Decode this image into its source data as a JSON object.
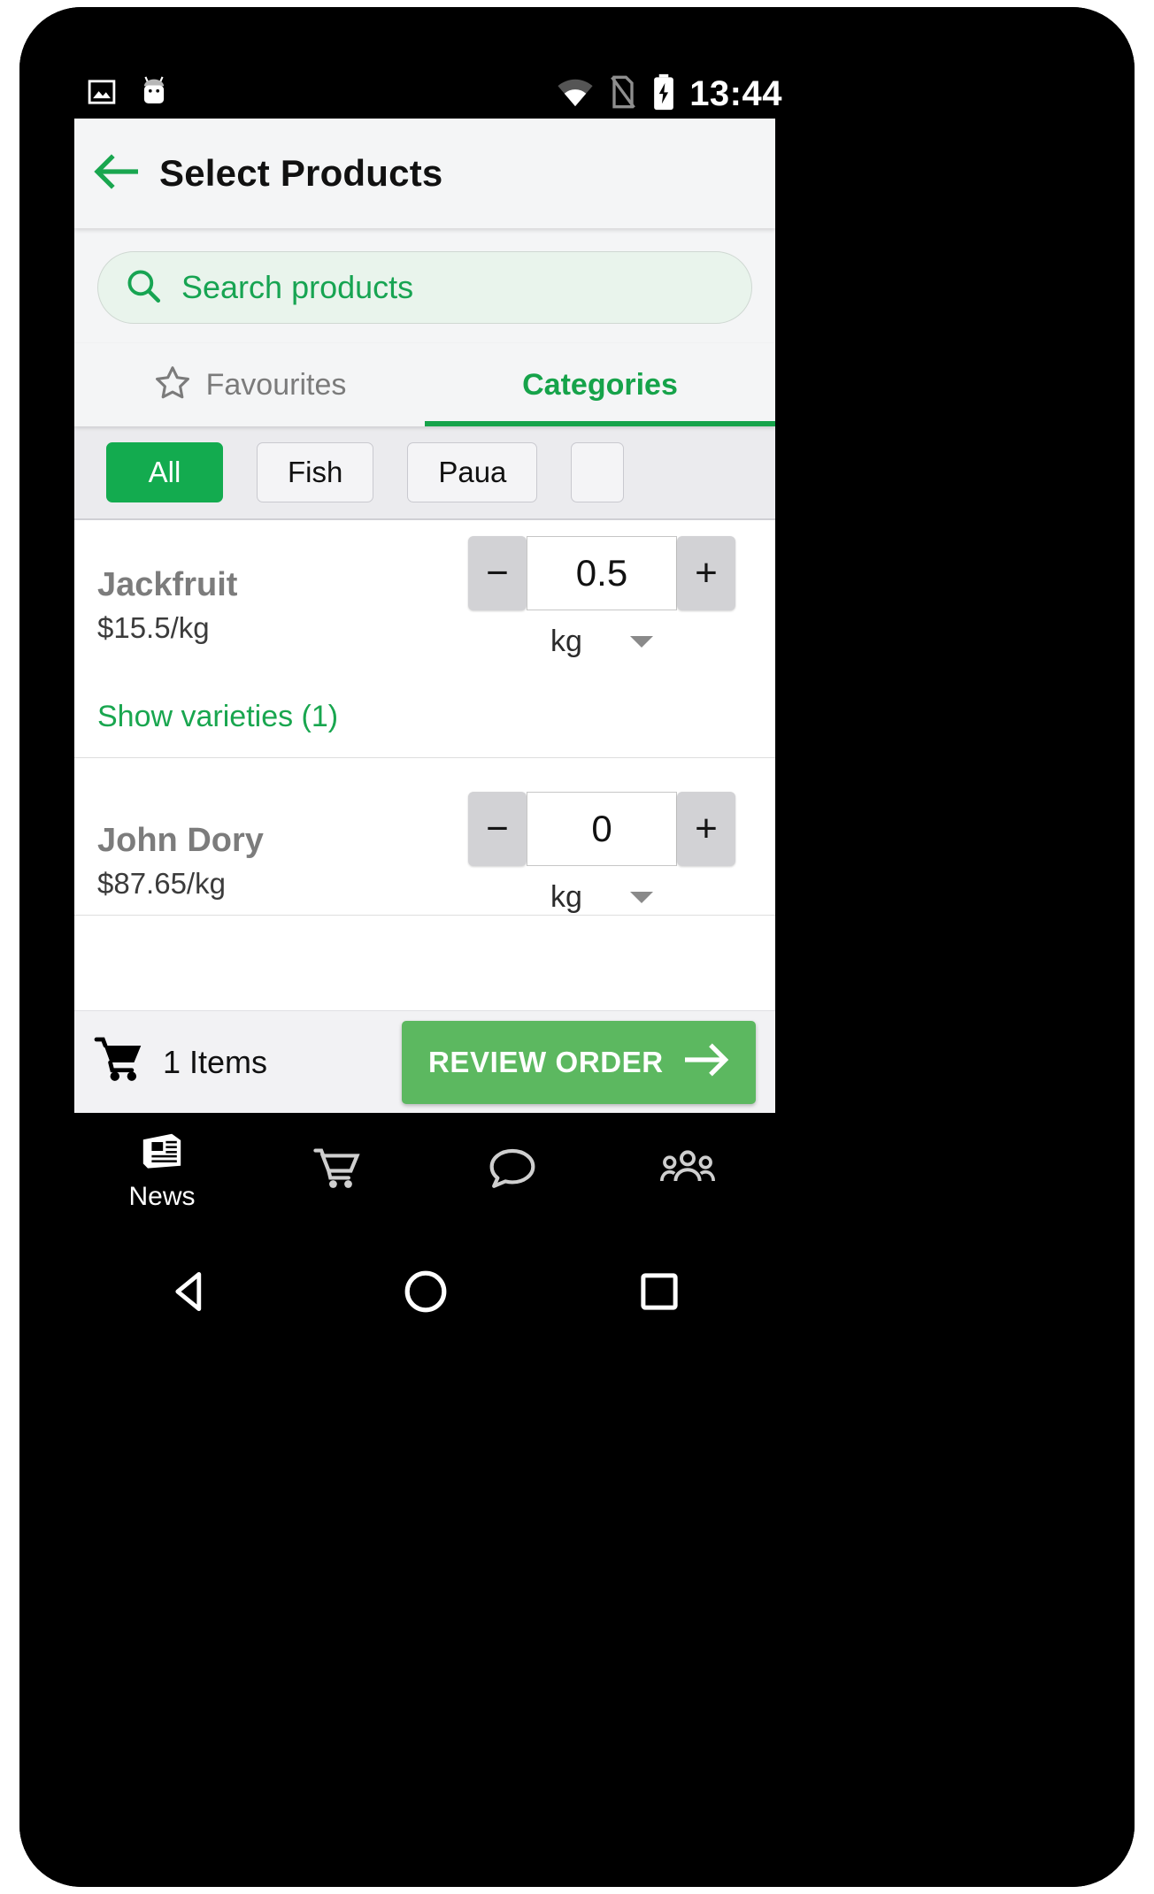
{
  "status_bar": {
    "time": "13:44",
    "icons": [
      "image-icon",
      "android-mascot-icon",
      "wifi-icon",
      "no-sim-icon",
      "battery-charging-icon"
    ]
  },
  "toolbar": {
    "back_icon": "arrow-left-icon",
    "title": "Select Products"
  },
  "search": {
    "icon": "search-icon",
    "placeholder": "Search products",
    "value": ""
  },
  "tabs": [
    {
      "label": "Favourites",
      "icon": "star-outline-icon",
      "active": false
    },
    {
      "label": "Categories",
      "icon": "",
      "active": true
    }
  ],
  "category_chips": [
    {
      "label": "All",
      "selected": true
    },
    {
      "label": "Fish",
      "selected": false
    },
    {
      "label": "Paua",
      "selected": false
    },
    {
      "label": "",
      "selected": false
    }
  ],
  "products": [
    {
      "name": "Jackfruit",
      "price": "$15.5/kg",
      "quantity": "0.5",
      "unit": "kg",
      "minus_label": "−",
      "plus_label": "+",
      "varieties_label": "Show varieties (1)"
    },
    {
      "name": "John Dory",
      "price": "$87.65/kg",
      "quantity": "0",
      "unit": "kg",
      "minus_label": "−",
      "plus_label": "+",
      "varieties_label": ""
    }
  ],
  "action_bar": {
    "cart_icon": "shopping-cart-icon",
    "items_count": "1 Items",
    "review_label": "REVIEW ORDER",
    "review_arrow_icon": "arrow-right-icon",
    "accent_color": "#5cb860"
  },
  "bottom_nav": [
    {
      "label": "News",
      "icon": "newspaper-icon"
    },
    {
      "label": "",
      "icon": "shopping-cart-icon"
    },
    {
      "label": "",
      "icon": "chat-bubble-icon"
    },
    {
      "label": "",
      "icon": "people-group-icon"
    }
  ],
  "system_nav": [
    {
      "icon": "back-triangle-icon"
    },
    {
      "icon": "home-circle-icon"
    },
    {
      "icon": "recents-square-icon"
    }
  ],
  "colors": {
    "brand_green": "#13ab4f",
    "link_green": "#19a64f",
    "search_bg": "#e9f4ec"
  }
}
